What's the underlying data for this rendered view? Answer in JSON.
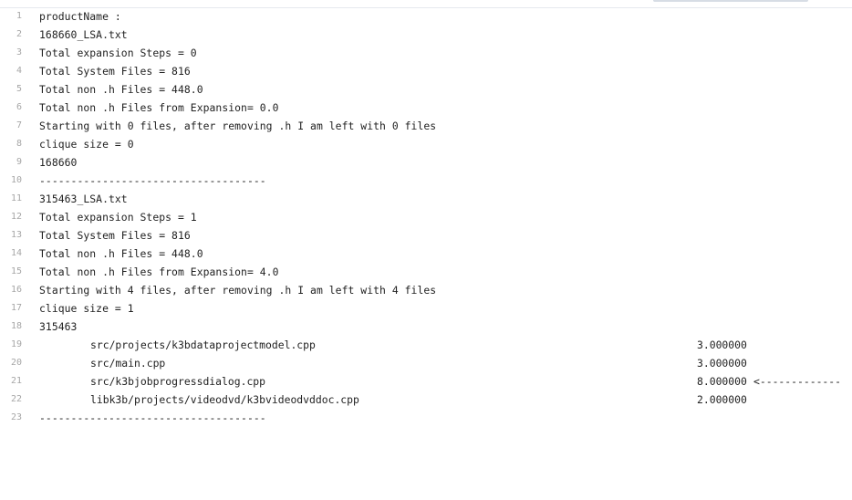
{
  "log_lines": {
    "l1": "productName :",
    "l2": "168660_LSA.txt",
    "l3": "Total expansion Steps = 0",
    "l4": "Total System Files = 816",
    "l5": "Total non .h Files = 448.0",
    "l6": "Total non .h Files from Expansion= 0.0",
    "l7": "Starting with 0 files, after removing .h I am left with 0 files",
    "l8": "clique size = 0",
    "l9": "168660",
    "l10": "------------------------------------",
    "l11": "315463_LSA.txt",
    "l12": "Total expansion Steps = 1",
    "l13": "Total System Files = 816",
    "l14": "Total non .h Files = 448.0",
    "l15": "Total non .h Files from Expansion= 4.0",
    "l16": "Starting with 4 files, after removing .h I am left with 4 files",
    "l17": "clique size = 1",
    "l18": "315463",
    "l23": "------------------------------------"
  },
  "file_rows": [
    {
      "line_number": "19",
      "path": "src/projects/k3bdataprojectmodel.cpp",
      "value": "3.000000",
      "marker": ""
    },
    {
      "line_number": "20",
      "path": "src/main.cpp",
      "value": "3.000000",
      "marker": ""
    },
    {
      "line_number": "21",
      "path": "src/k3bjobprogressdialog.cpp",
      "value": "8.000000",
      "marker": "<-------------"
    },
    {
      "line_number": "22",
      "path": "libk3b/projects/videodvd/k3bvideodvddoc.cpp",
      "value": "2.000000",
      "marker": ""
    }
  ],
  "line_numbers": {
    "n1": "1",
    "n2": "2",
    "n3": "3",
    "n4": "4",
    "n5": "5",
    "n6": "6",
    "n7": "7",
    "n8": "8",
    "n9": "9",
    "n10": "10",
    "n11": "11",
    "n12": "12",
    "n13": "13",
    "n14": "14",
    "n15": "15",
    "n16": "16",
    "n17": "17",
    "n18": "18",
    "n23": "23"
  }
}
